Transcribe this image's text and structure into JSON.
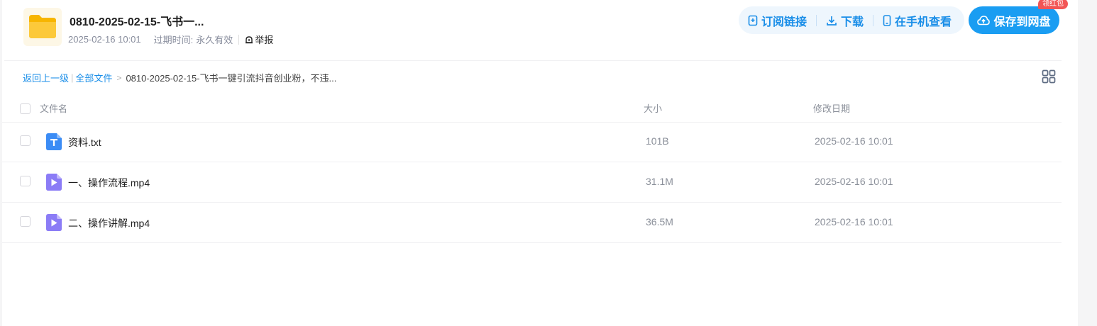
{
  "header": {
    "title": "0810-2025-02-15-飞书一...",
    "share_date": "2025-02-16 10:01",
    "expiry_label": "过期时间:",
    "expiry_value": "永久有效",
    "report_label": "举报",
    "folder_icon": "folder-icon"
  },
  "actions": {
    "subscribe_label": "订阅链接",
    "download_label": "下载",
    "mobile_label": "在手机查看",
    "save_label": "保存到网盘",
    "badge_label": "领红包"
  },
  "breadcrumb": {
    "back_label": "返回上一级",
    "all_files_label": "全部文件",
    "current": "0810-2025-02-15-飞书一键引流抖音创业粉，不违..."
  },
  "table": {
    "columns": {
      "name": "文件名",
      "size": "大小",
      "date": "修改日期"
    },
    "rows": [
      {
        "name": "资料.txt",
        "size": "101B",
        "date": "2025-02-16 10:01",
        "icon": "text-file-icon"
      },
      {
        "name": "一、操作流程.mp4",
        "size": "31.1M",
        "date": "2025-02-16 10:01",
        "icon": "video-file-icon"
      },
      {
        "name": "二、操作讲解.mp4",
        "size": "36.5M",
        "date": "2025-02-16 10:01",
        "icon": "video-file-icon"
      }
    ]
  },
  "colors": {
    "accent": "#1a9df2",
    "link": "#1a8ee8",
    "badge": "#f25555",
    "folder": "#fbc02d",
    "text_icon": "#3b8cf5",
    "video_icon": "#8b7cf6"
  }
}
